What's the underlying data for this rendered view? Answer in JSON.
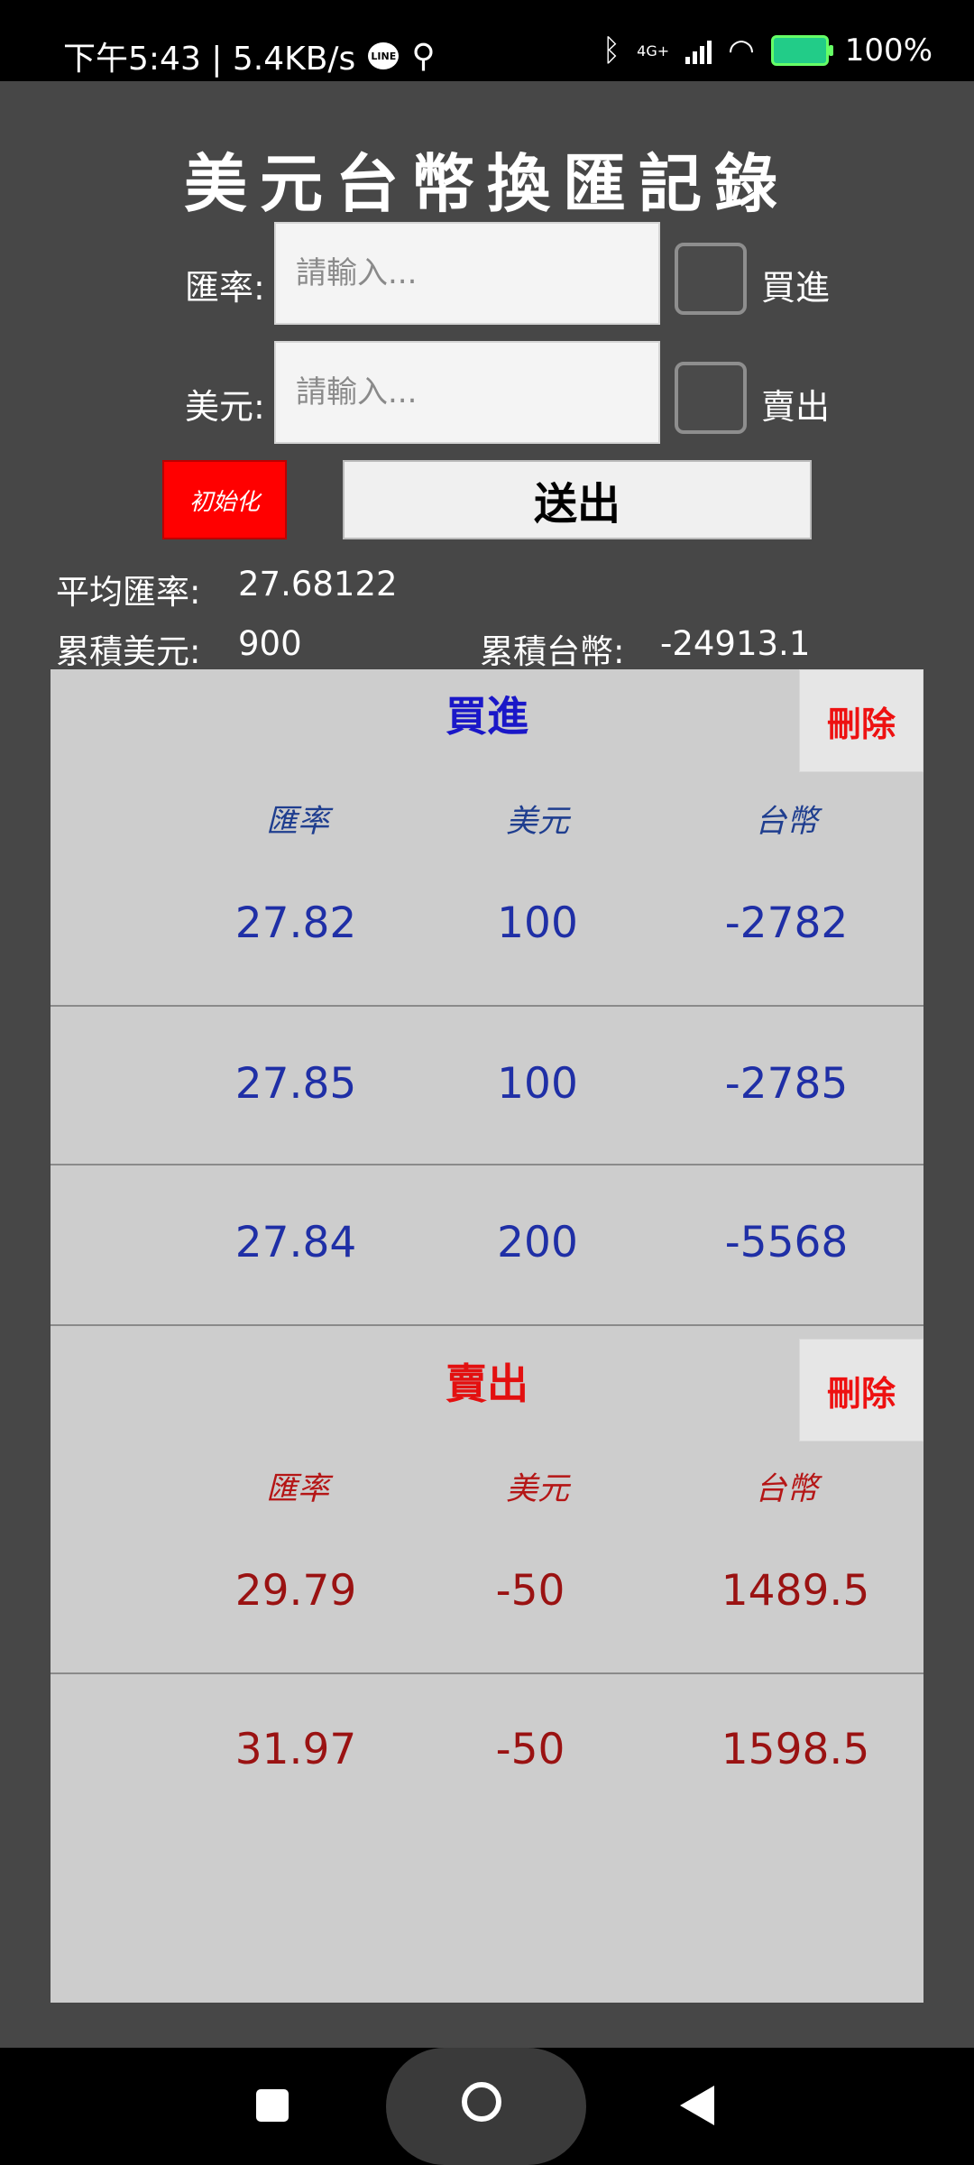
{
  "status_bar": {
    "time_speed": "下午5:43 | 5.4KB/s",
    "network": "4G+",
    "battery": "100%"
  },
  "title": "美元台幣換匯記錄",
  "form": {
    "rate_label": "匯率:",
    "usd_label": "美元:",
    "placeholder": "請輸入...",
    "buy_label": "買進",
    "sell_label": "賣出",
    "init_button": "初始化",
    "send_button": "送出"
  },
  "summary": {
    "avg_rate_label": "平均匯率:",
    "avg_rate_value": "27.68122",
    "total_usd_label": "累積美元:",
    "total_usd_value": "900",
    "total_twd_label": "累積台幣:",
    "total_twd_value": "-24913.1"
  },
  "buy": {
    "title": "買進",
    "delete": "刪除",
    "headers": [
      "匯率",
      "美元",
      "台幣"
    ],
    "rows": [
      [
        "27.82",
        "100",
        "-2782"
      ],
      [
        "27.85",
        "100",
        "-2785"
      ],
      [
        "27.84",
        "200",
        "-5568"
      ]
    ]
  },
  "sell": {
    "title": "賣出",
    "delete": "刪除",
    "headers": [
      "匯率",
      "美元",
      "台幣"
    ],
    "rows": [
      [
        "29.79",
        "-50",
        "1489.5"
      ],
      [
        "31.97",
        "-50",
        "1598.5"
      ]
    ]
  },
  "colors": {
    "background": "#474747",
    "panel": "#cdcdcd",
    "buy_text": "#1f2fa6",
    "sell_text": "#9a1212",
    "delete_text": "#e11111",
    "init_button": "#ff0000"
  },
  "icons": {
    "nav_recent": "square-icon",
    "nav_home": "home-circle-icon",
    "nav_back": "back-triangle-icon"
  }
}
